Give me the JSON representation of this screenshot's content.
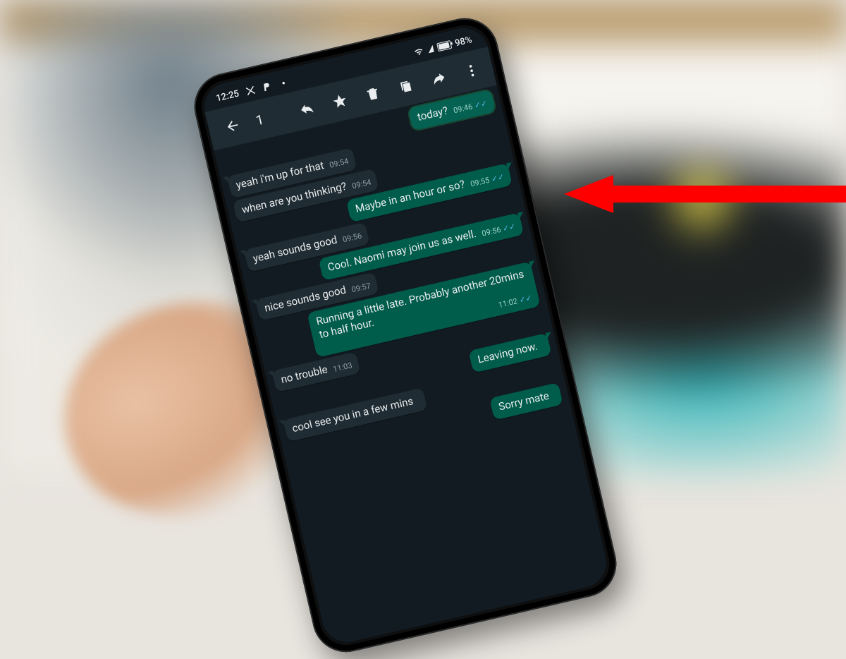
{
  "status_bar": {
    "time": "12:25",
    "battery_pct": "98%"
  },
  "action_bar": {
    "selected_count": "1"
  },
  "messages": [
    {
      "dir": "out",
      "text": "today?",
      "time": "09:46",
      "ticks": true,
      "selected": true,
      "continued": true
    },
    {
      "dir": "in",
      "text": "yeah i'm up for that",
      "time": "09:54"
    },
    {
      "dir": "in",
      "text": "when are you thinking?",
      "time": "09:54",
      "continued": true
    },
    {
      "dir": "out",
      "text": "Maybe in an hour or so?",
      "time": "09:55",
      "ticks": true
    },
    {
      "dir": "in",
      "text": "yeah sounds good",
      "time": "09:56"
    },
    {
      "dir": "out",
      "text": "Cool. Naomi may join us as well.",
      "time": "09:56",
      "ticks": true
    },
    {
      "dir": "in",
      "text": "nice sounds good",
      "time": "09:57"
    },
    {
      "dir": "out",
      "text": "Running a little late. Probably another 20mins to half hour.",
      "time": "11:02",
      "ticks": true
    },
    {
      "dir": "in",
      "text": "no trouble",
      "time": "11:03"
    },
    {
      "dir": "out",
      "text": "Leaving now.",
      "time": "",
      "ticks": false
    },
    {
      "dir": "in",
      "text": "cool see you in a few mins",
      "time": ""
    },
    {
      "dir": "out",
      "text": "Sorry mate",
      "time": "",
      "ticks": false,
      "continued": true
    }
  ],
  "annotation": {
    "arrow_target": "overflow-menu-icon"
  }
}
